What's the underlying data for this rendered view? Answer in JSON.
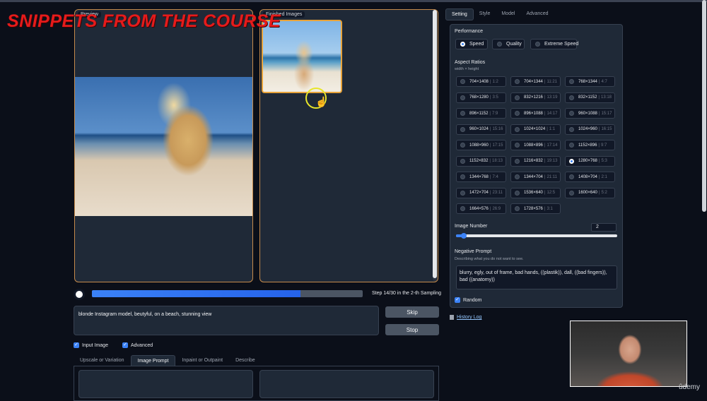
{
  "overlay": {
    "course_banner": "SNIPPETS FROM THE COURSE"
  },
  "gallery": {
    "preview_label": "Preview",
    "finished_label": "Finished Images"
  },
  "progress": {
    "percent": 77,
    "text": "Step 14/30 in the 2-th Sampling"
  },
  "prompt": {
    "value": "blonde Instagram model, beutyful, on a beach, stunning view"
  },
  "buttons": {
    "skip": "Skip",
    "stop": "Stop"
  },
  "checkboxes": {
    "input_image": "Input Image",
    "advanced": "Advanced"
  },
  "bottom_tabs": [
    "Upscale or Variation",
    "Image Prompt",
    "Inpaint or Outpaint",
    "Describe"
  ],
  "bottom_tabs_active": 1,
  "right_tabs": [
    "Setting",
    "Style",
    "Model",
    "Advanced"
  ],
  "right_tabs_active": 0,
  "performance": {
    "title": "Performance",
    "options": [
      "Speed",
      "Quality",
      "Extreme Speed"
    ],
    "selected": 0
  },
  "aspect": {
    "title": "Aspect Ratios",
    "subtitle": "width × height",
    "selected": 17,
    "items": [
      {
        "size": "704×1408",
        "ratio": "1:2"
      },
      {
        "size": "704×1344",
        "ratio": "11:21"
      },
      {
        "size": "768×1344",
        "ratio": "4:7"
      },
      {
        "size": "768×1280",
        "ratio": "3:5"
      },
      {
        "size": "832×1216",
        "ratio": "13:19"
      },
      {
        "size": "832×1152",
        "ratio": "13:18"
      },
      {
        "size": "896×1152",
        "ratio": "7:9"
      },
      {
        "size": "896×1088",
        "ratio": "14:17"
      },
      {
        "size": "960×1088",
        "ratio": "15:17"
      },
      {
        "size": "960×1024",
        "ratio": "15:16"
      },
      {
        "size": "1024×1024",
        "ratio": "1:1"
      },
      {
        "size": "1024×960",
        "ratio": "16:15"
      },
      {
        "size": "1088×960",
        "ratio": "17:15"
      },
      {
        "size": "1088×896",
        "ratio": "17:14"
      },
      {
        "size": "1152×896",
        "ratio": "9:7"
      },
      {
        "size": "1152×832",
        "ratio": "18:13"
      },
      {
        "size": "1216×832",
        "ratio": "19:13"
      },
      {
        "size": "1280×768",
        "ratio": "5:3"
      },
      {
        "size": "1344×768",
        "ratio": "7:4"
      },
      {
        "size": "1344×704",
        "ratio": "21:11"
      },
      {
        "size": "1408×704",
        "ratio": "2:1"
      },
      {
        "size": "1472×704",
        "ratio": "23:11"
      },
      {
        "size": "1536×640",
        "ratio": "12:5"
      },
      {
        "size": "1600×640",
        "ratio": "5:2"
      },
      {
        "size": "1664×576",
        "ratio": "26:9"
      },
      {
        "size": "1728×576",
        "ratio": "3:1"
      }
    ]
  },
  "image_number": {
    "title": "Image Number",
    "value": "2",
    "slider_fraction": 0.04
  },
  "negative_prompt": {
    "title": "Negative Prompt",
    "subtitle": "Describing what you do not want to see.",
    "value": "blurry, egly, out of frame, bad hands, ((plastik)), dall, ((bad fingers)), bad ((anatomy))"
  },
  "random": {
    "label": "Random"
  },
  "history": {
    "label": "History Log"
  },
  "watermark": {
    "label": "ûdemy"
  }
}
